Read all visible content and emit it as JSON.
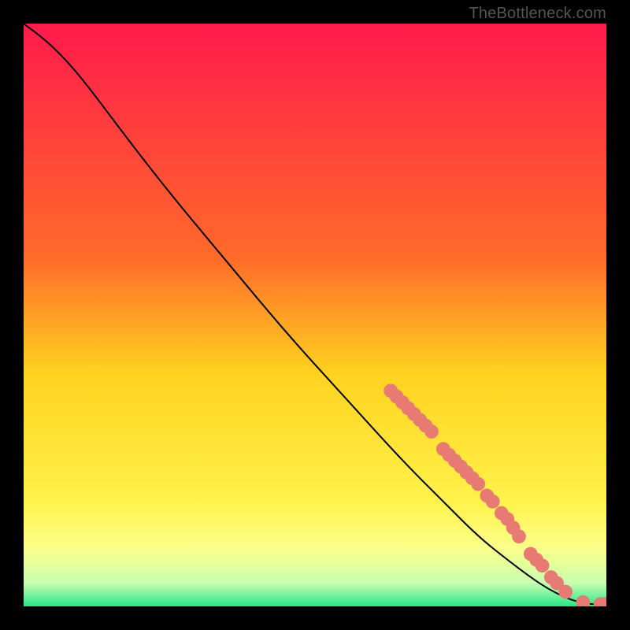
{
  "watermark": "TheBottleneck.com",
  "chart_data": {
    "type": "line",
    "title": "",
    "xlabel": "",
    "ylabel": "",
    "xlim": [
      0,
      100
    ],
    "ylim": [
      0,
      100
    ],
    "gradient_stops": [
      {
        "offset": 0,
        "color": "#ff1a4b"
      },
      {
        "offset": 40,
        "color": "#ff6a2a"
      },
      {
        "offset": 60,
        "color": "#ffd21f"
      },
      {
        "offset": 82,
        "color": "#fff24a"
      },
      {
        "offset": 90,
        "color": "#fcff8a"
      },
      {
        "offset": 96,
        "color": "#c8ffb0"
      },
      {
        "offset": 100,
        "color": "#29e68a"
      }
    ],
    "series": [
      {
        "name": "curve",
        "color": "#000000",
        "x": [
          0,
          4,
          8,
          12,
          18,
          25,
          35,
          45,
          55,
          65,
          72,
          78,
          83,
          87,
          90,
          93,
          95,
          97,
          100
        ],
        "y": [
          100,
          97,
          93,
          88,
          80,
          71,
          59,
          47,
          36,
          25,
          18,
          12,
          8,
          5,
          3,
          1.5,
          0.8,
          0.4,
          0.3
        ]
      }
    ],
    "markers": {
      "name": "highlighted-points",
      "color": "#e77a73",
      "radius": 1.2,
      "points": [
        {
          "x": 63,
          "y": 37
        },
        {
          "x": 64,
          "y": 36
        },
        {
          "x": 65,
          "y": 35
        },
        {
          "x": 66,
          "y": 34
        },
        {
          "x": 67,
          "y": 33
        },
        {
          "x": 68,
          "y": 32
        },
        {
          "x": 69,
          "y": 31
        },
        {
          "x": 70,
          "y": 30
        },
        {
          "x": 72,
          "y": 27
        },
        {
          "x": 73,
          "y": 26
        },
        {
          "x": 74,
          "y": 25
        },
        {
          "x": 75,
          "y": 24
        },
        {
          "x": 76,
          "y": 23
        },
        {
          "x": 77,
          "y": 22
        },
        {
          "x": 78,
          "y": 21
        },
        {
          "x": 79.5,
          "y": 19
        },
        {
          "x": 80.5,
          "y": 18
        },
        {
          "x": 82,
          "y": 16
        },
        {
          "x": 83,
          "y": 15
        },
        {
          "x": 84,
          "y": 13.5
        },
        {
          "x": 85,
          "y": 12
        },
        {
          "x": 87,
          "y": 9
        },
        {
          "x": 88,
          "y": 8
        },
        {
          "x": 89,
          "y": 7
        },
        {
          "x": 90.5,
          "y": 5
        },
        {
          "x": 91.5,
          "y": 4
        },
        {
          "x": 93,
          "y": 2.5
        },
        {
          "x": 96,
          "y": 0.7
        },
        {
          "x": 99,
          "y": 0.4
        },
        {
          "x": 100,
          "y": 0.4
        }
      ]
    }
  }
}
